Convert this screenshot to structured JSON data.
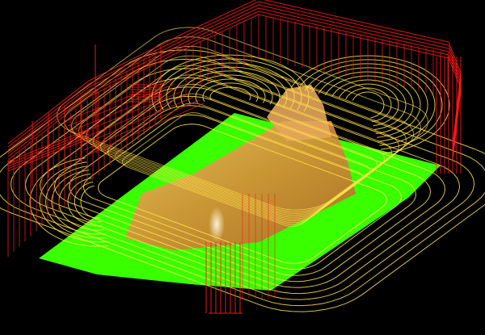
{
  "viewport": {
    "background": "#000000",
    "rapid_move_color": "#ff1a1a",
    "cut_path_color": "#ffe24a",
    "stock_color": "#39ff00",
    "model_color": "#d99a3a",
    "model_highlight_color": "#fff1c4"
  }
}
